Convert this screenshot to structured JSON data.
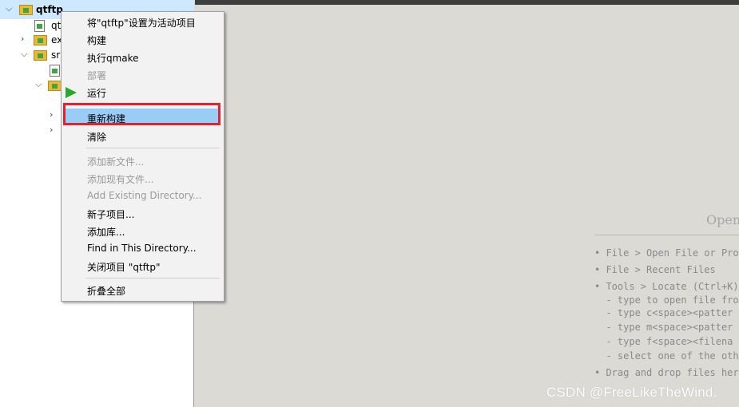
{
  "tree": {
    "root": "qtftp",
    "rows": [
      "qt",
      "ex",
      "sr"
    ]
  },
  "menu": {
    "set_active": "将\"qtftp\"设置为活动项目",
    "build": "构建",
    "run_qmake": "执行qmake",
    "deploy": "部署",
    "run": "运行",
    "rebuild": "重新构建",
    "clean": "清除",
    "add_new_file": "添加新文件...",
    "add_existing_files": "添加现有文件...",
    "add_existing_dir": "Add Existing Directory...",
    "new_subproject": "新子项目...",
    "add_library": "添加库...",
    "find_in_dir": "Find in This Directory...",
    "close_project": "关闭项目 \"qtftp\"",
    "collapse_all": "折叠全部"
  },
  "editor": {
    "open_title": "Open",
    "hints": [
      "• File > Open File or Proj",
      "• File > Recent Files",
      "• Tools > Locate (Ctrl+K)",
      "  - type to open file from",
      "  - type c<space><patter",
      "  - type m<space><patter",
      "  - type f<space><filena",
      "  - select one of the othe",
      "• Drag and drop files here"
    ]
  },
  "watermark": "CSDN @FreeLikeTheWind.",
  "colors": {
    "highlight": "#99ccf7",
    "annotation": "#e3222b",
    "run": "#2aa82a"
  }
}
